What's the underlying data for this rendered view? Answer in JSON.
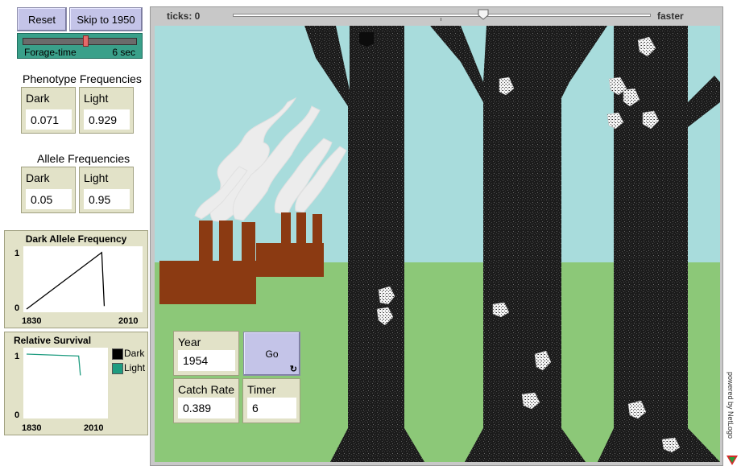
{
  "controls": {
    "reset_label": "Reset",
    "skip_label": "Skip to 1950",
    "go_label": "Go",
    "forever_icon": "forever-icon"
  },
  "slider": {
    "label": "Forage-time",
    "value_text": "6 sec",
    "fraction": 0.55
  },
  "speed": {
    "ticks_label": "ticks: 0",
    "faster_label": "faster",
    "fraction": 0.6
  },
  "phenotype": {
    "title": "Phenotype Frequencies",
    "dark_label": "Dark",
    "dark_value": "0.071",
    "light_label": "Light",
    "light_value": "0.929"
  },
  "allele": {
    "title": "Allele Frequencies",
    "dark_label": "Dark",
    "dark_value": "0.05",
    "light_label": "Light",
    "light_value": "0.95"
  },
  "monitors": {
    "year_label": "Year",
    "year_value": "1954",
    "catch_label": "Catch Rate",
    "catch_value": "0.389",
    "timer_label": "Timer",
    "timer_value": "6"
  },
  "dark_plot": {
    "title": "Dark Allele Frequency",
    "ymax": "1",
    "ymin": "0",
    "xmin": "1830",
    "xmax": "2010",
    "line_color": "#000000"
  },
  "survival_plot": {
    "title": "Relative Survival",
    "ymax": "1",
    "ymin": "0",
    "xmin": "1830",
    "xmax": "2010",
    "legend_dark": "Dark",
    "legend_light": "Light",
    "dark_color": "#000000",
    "light_color": "#1f9c80"
  },
  "branding": {
    "text": "powered by NetLogo",
    "logo_icon": "netlogo-logo-icon"
  },
  "colors": {
    "sky": "#a8dcdc",
    "grass": "#8cc878",
    "factory": "#8b3a12",
    "smoke": "#e8e8e8",
    "trunk": "#1a1a1a",
    "control_bg": "#e2e2c8",
    "button_bg": "#c4c4e8"
  },
  "chart_data": [
    {
      "type": "line",
      "title": "Dark Allele Frequency",
      "xlim": [
        1830,
        2010
      ],
      "ylim": [
        0,
        1
      ],
      "series": [
        {
          "values": [
            [
              1830,
              0.0
            ],
            [
              1950,
              0.95
            ],
            [
              1954,
              0.05
            ]
          ]
        }
      ]
    },
    {
      "type": "line",
      "title": "Relative Survival",
      "xlim": [
        1830,
        2010
      ],
      "ylim": [
        0,
        1
      ],
      "series": [
        {
          "name": "Light",
          "values": [
            [
              1830,
              0.95
            ],
            [
              1950,
              0.92
            ],
            [
              1954,
              0.62
            ]
          ]
        }
      ]
    }
  ]
}
